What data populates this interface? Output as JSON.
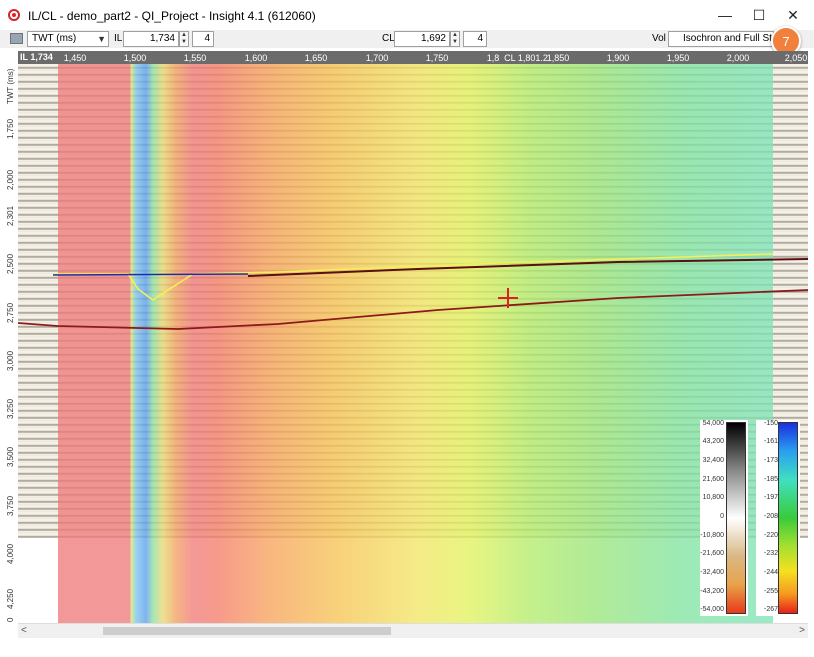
{
  "window": {
    "title": "IL/CL - demo_part2 - QI_Project - Insight 4.1 (612060)",
    "minimize": "—",
    "maximize": "☐",
    "close": "✕"
  },
  "toolbar": {
    "domain_select": "TWT (ms)",
    "il_label": "IL",
    "il_value": "1,734",
    "il_step": "4",
    "cl_label": "CL",
    "cl_value": "1,692",
    "cl_step": "4",
    "vol_label": "Vol",
    "vol_select": "Isochron and Full Stack"
  },
  "badge": "7",
  "ruler": {
    "il_tag": "IL 1,734",
    "ticks": [
      "1,450",
      "1,500",
      "1,550",
      "1,600",
      "1,650",
      "1,700",
      "1,750",
      "1,8",
      "CL 1,801.2",
      "1,850",
      "1,900",
      "1,950",
      "2,000",
      "2,050"
    ]
  },
  "vaxis": {
    "label": "TWT (ms)",
    "ticks": [
      "1,750",
      "2,000",
      "2,301",
      "2,500",
      "2,750",
      "3,000",
      "3,250",
      "3,500",
      "3,750",
      "4,000",
      "4,250",
      "0"
    ]
  },
  "colorbar_seismic": {
    "labels": [
      "54,000",
      "43,200",
      "32,400",
      "21,600",
      "10,800",
      "0",
      "-10,800",
      "-21,600",
      "-32,400",
      "-43,200",
      "-54,000"
    ]
  },
  "colorbar_isochron": {
    "labels": [
      "-150",
      "-161",
      "-173",
      "-185",
      "-197",
      "-208",
      "-220",
      "-232",
      "-244",
      "-255",
      "-267"
    ]
  },
  "scroll": {
    "left": "<",
    "right": ">"
  },
  "colors": {
    "accent": "#f0803c",
    "horizon_red": "#8b1a1a",
    "horizon_yellow": "#f5ef5a",
    "horizon_blue": "#1c2fa0"
  }
}
